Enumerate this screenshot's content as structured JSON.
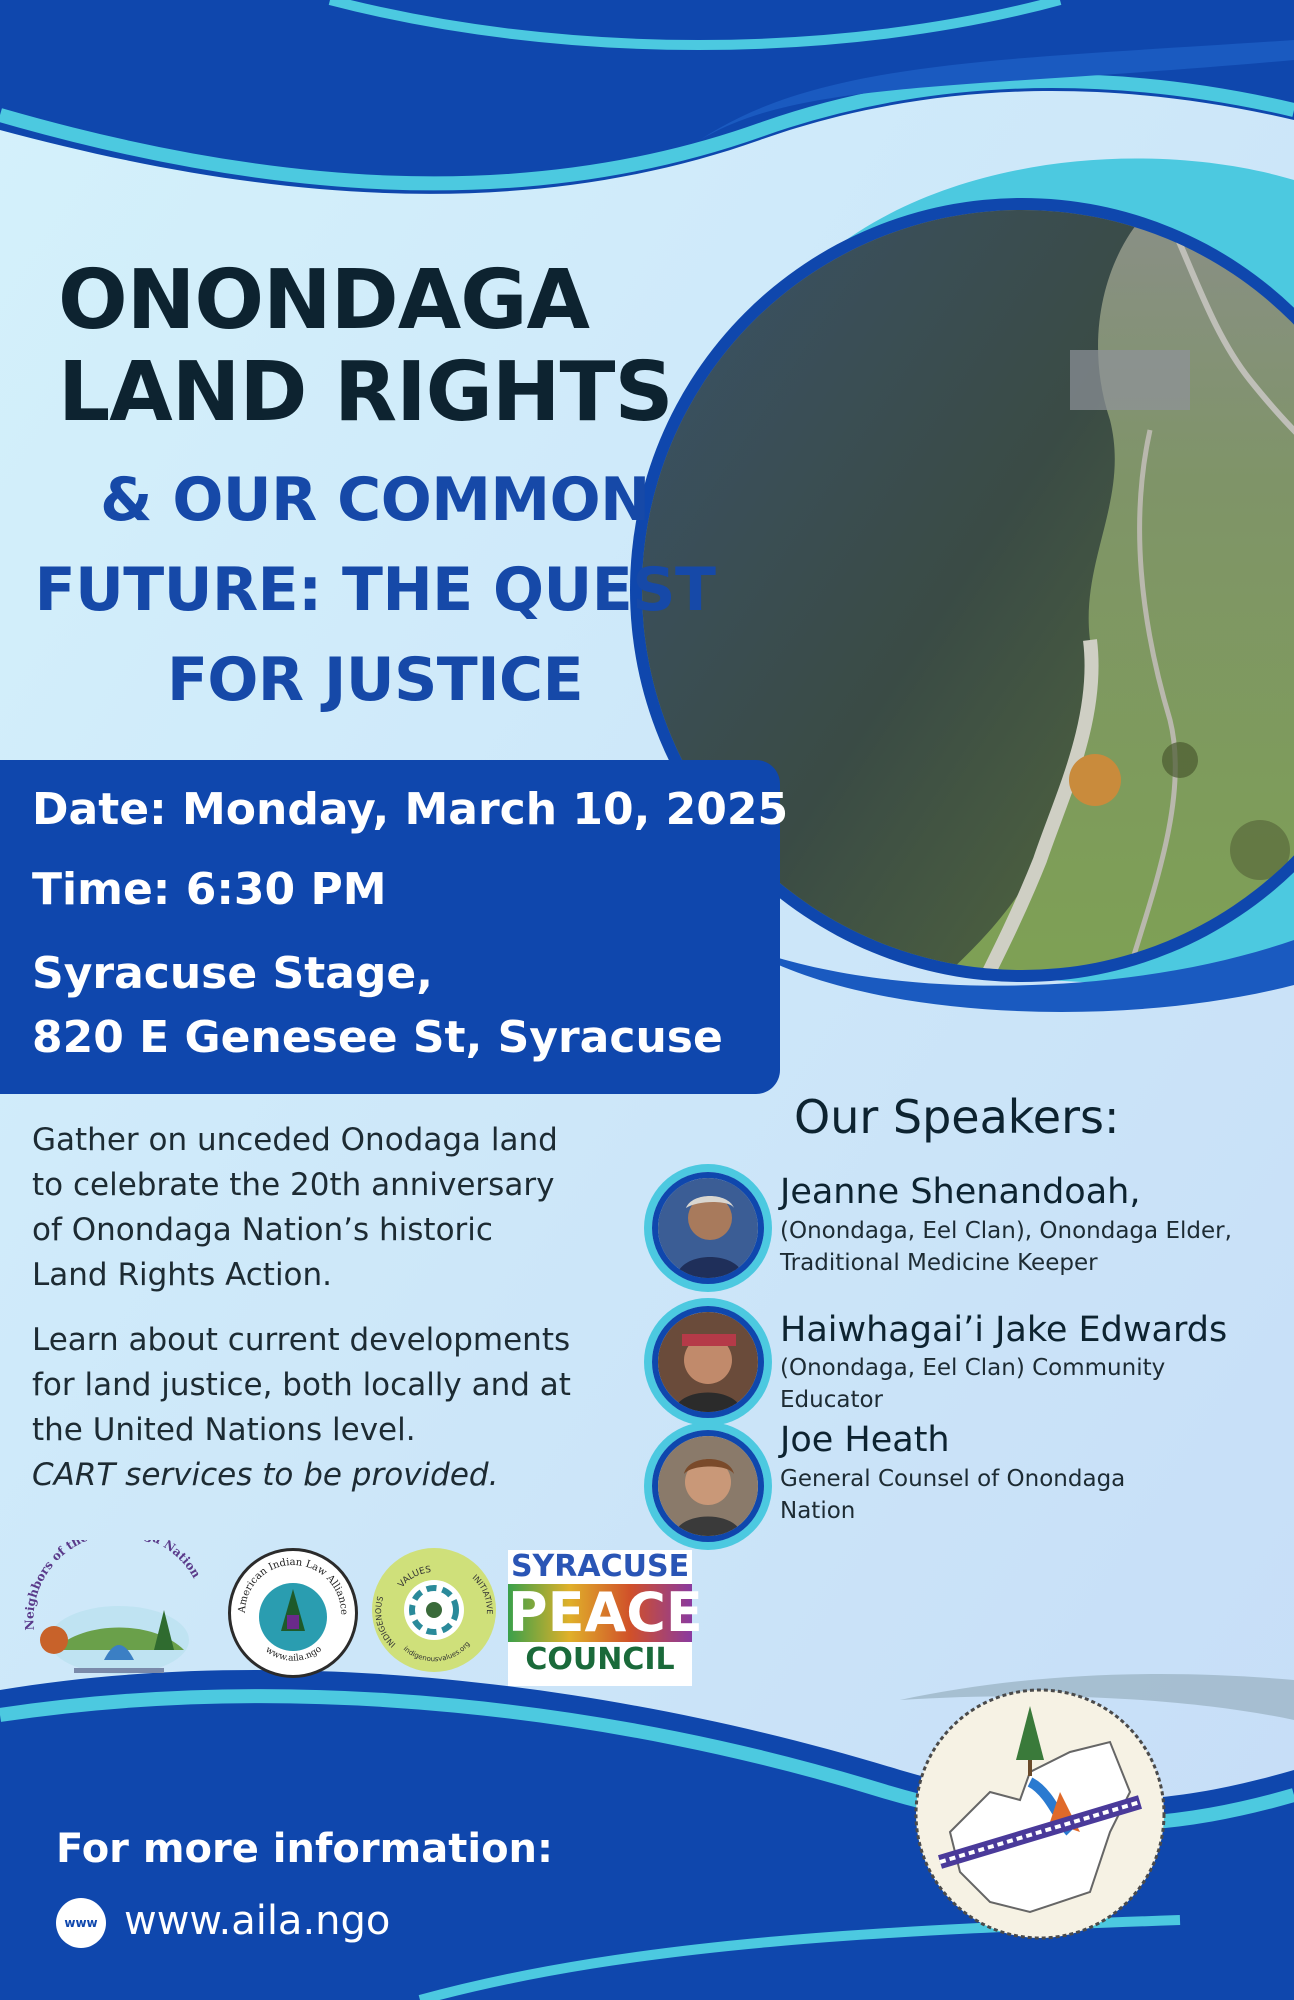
{
  "title": {
    "line1": "ONONDAGA",
    "line2": "LAND RIGHTS",
    "sub1": "& OUR COMMON",
    "sub2": "FUTURE: THE QUEST",
    "sub3": "FOR JUSTICE"
  },
  "event": {
    "date": "Date: Monday, March 10, 2025",
    "time": "Time: 6:30 PM",
    "venue1": "Syracuse Stage,",
    "venue2": "820 E Genesee St, Syracuse"
  },
  "description": {
    "p1": [
      "Gather on unceded Onodaga land",
      "to celebrate the 20th anniversary",
      "of Onondaga Nation’s historic",
      "Land Rights Action."
    ],
    "p2": [
      "Learn about current developments",
      "for land justice, both locally and at",
      "the United Nations level."
    ],
    "p2_italic": "CART services to be provided."
  },
  "speakers": {
    "heading": "Our Speakers:",
    "list": [
      {
        "name": "Jeanne Shenandoah,",
        "desc1": "(Onondaga, Eel Clan),  Onondaga Elder,",
        "desc2": "Traditional Medicine Keeper"
      },
      {
        "name": "Haiwhagai’i Jake Edwards",
        "desc1": "(Onondaga, Eel Clan) Community",
        "desc2": "Educator"
      },
      {
        "name": "Joe Heath",
        "desc1": "General Counsel of Onondaga",
        "desc2": "Nation"
      }
    ]
  },
  "logos": {
    "neighbors": "Neighbors of the Onondaga Nation",
    "aila_top": "American Indian Law Alliance",
    "aila_bottom": "www.aila.ngo",
    "values_top": "VALUES",
    "values_left": "INDIGENOUS",
    "values_right": "INITIATIVE",
    "values_bottom": "indigenousvalues.org",
    "peace1": "SYRACUSE",
    "peace2": "PEACE",
    "peace3": "COUNCIL"
  },
  "footer": {
    "more_info": "For more information:",
    "url": "www.aila.ngo",
    "icon_text": "www"
  },
  "colors": {
    "navy": "#0f47ad",
    "teal": "#4cc9e0",
    "light_bg": "#cfeefa",
    "dark_text": "#0d2330"
  }
}
